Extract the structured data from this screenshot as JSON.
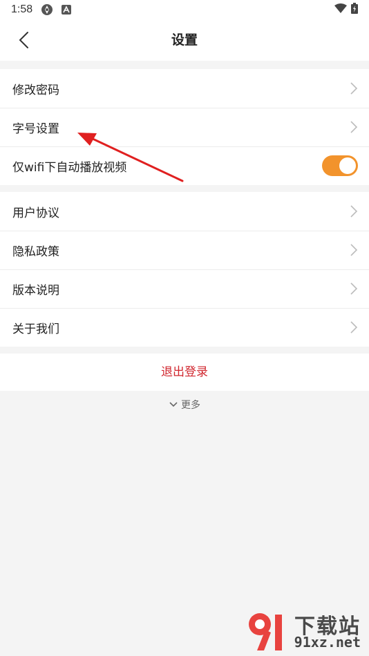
{
  "status_bar": {
    "time": "1:58"
  },
  "header": {
    "title": "设置"
  },
  "groups": [
    {
      "items": [
        {
          "label": "修改密码",
          "type": "link"
        },
        {
          "label": "字号设置",
          "type": "link"
        },
        {
          "label": "仅wifi下自动播放视频",
          "type": "toggle",
          "on": true
        }
      ]
    },
    {
      "items": [
        {
          "label": "用户协议",
          "type": "link"
        },
        {
          "label": "隐私政策",
          "type": "link"
        },
        {
          "label": "版本说明",
          "type": "link"
        },
        {
          "label": "关于我们",
          "type": "link"
        }
      ]
    }
  ],
  "logout_label": "退出登录",
  "more_label": "更多",
  "colors": {
    "accent_toggle": "#f2932c",
    "logout_text": "#d0262e",
    "annotation_arrow": "#e02020"
  },
  "watermark": {
    "text_top": "下载站",
    "text_bottom": "91xz.net"
  }
}
